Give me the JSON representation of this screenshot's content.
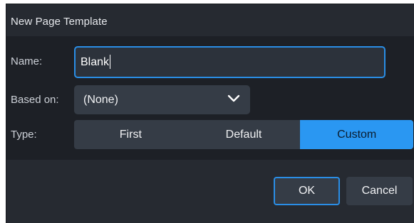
{
  "dialog": {
    "title": "New Page Template"
  },
  "form": {
    "name_label": "Name:",
    "name_value": "Blank",
    "based_on_label": "Based on:",
    "based_on_value": "(None)",
    "type_label": "Type:",
    "type_options": [
      "First",
      "Default",
      "Custom"
    ],
    "type_selected": "Custom"
  },
  "buttons": {
    "ok_label": "OK",
    "cancel_label": "Cancel"
  },
  "colors": {
    "accent": "#2a97f2",
    "dialog_bg": "#262a31",
    "panel_bg": "#1d2026",
    "control_bg": "#353c46"
  },
  "icons": {
    "dropdown": "chevron-down-icon"
  }
}
